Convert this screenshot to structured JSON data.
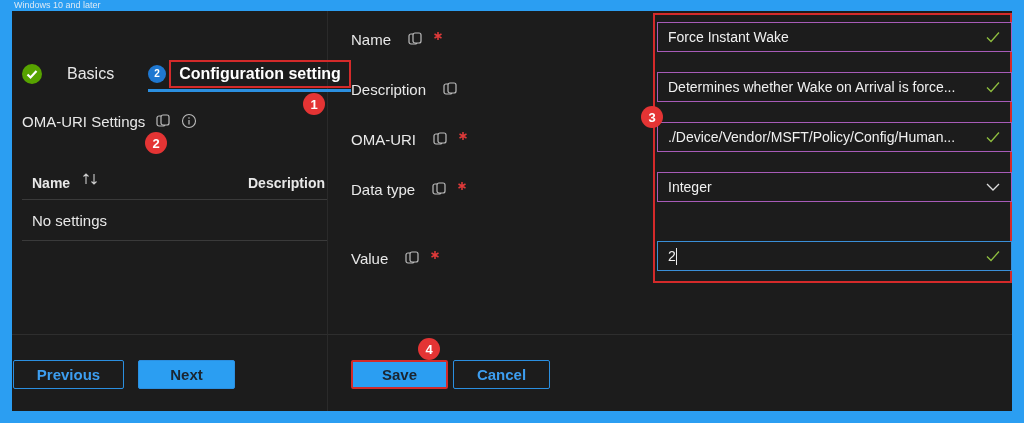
{
  "header": {
    "platform": "Windows 10 and later"
  },
  "steps": [
    {
      "label": "Basics",
      "kind": "done",
      "selected": false,
      "highlighted": false
    },
    {
      "label": "Configuration setting",
      "kind": "numbered",
      "marker": "2",
      "selected": true,
      "highlighted": true
    }
  ],
  "settings": {
    "title": "OMA-URI Settings",
    "columns": [
      {
        "label": "Name",
        "sortable": true
      },
      {
        "label": "Description",
        "sortable": false
      }
    ],
    "empty_text": "No settings"
  },
  "form": {
    "highlighted": true,
    "fields": [
      {
        "label": "Name",
        "required": true,
        "kind": "text",
        "value": "Force Instant Wake",
        "valid": true,
        "focused": false
      },
      {
        "label": "Description",
        "required": false,
        "kind": "text",
        "value": "Determines whether Wake on Arrival is force...",
        "valid": true,
        "focused": false
      },
      {
        "label": "OMA-URI",
        "required": true,
        "kind": "text",
        "value": "./Device/Vendor/MSFT/Policy/Config/Human...",
        "valid": true,
        "focused": false
      },
      {
        "label": "Data type",
        "required": true,
        "kind": "select",
        "value": "Integer",
        "focused": false
      },
      {
        "label": "Value",
        "required": true,
        "kind": "text",
        "value": "2",
        "valid": true,
        "focused": true
      }
    ]
  },
  "footer": {
    "wizard_buttons": [
      {
        "label": "Previous",
        "primary": false,
        "highlighted": false
      },
      {
        "label": "Next",
        "primary": true,
        "highlighted": false
      }
    ],
    "panel_buttons": [
      {
        "label": "Save",
        "primary": true,
        "highlighted": true
      },
      {
        "label": "Cancel",
        "primary": false,
        "highlighted": false
      }
    ]
  },
  "annotations": [
    {
      "number": "1"
    },
    {
      "number": "2"
    },
    {
      "number": "3"
    },
    {
      "number": "4"
    }
  ]
}
